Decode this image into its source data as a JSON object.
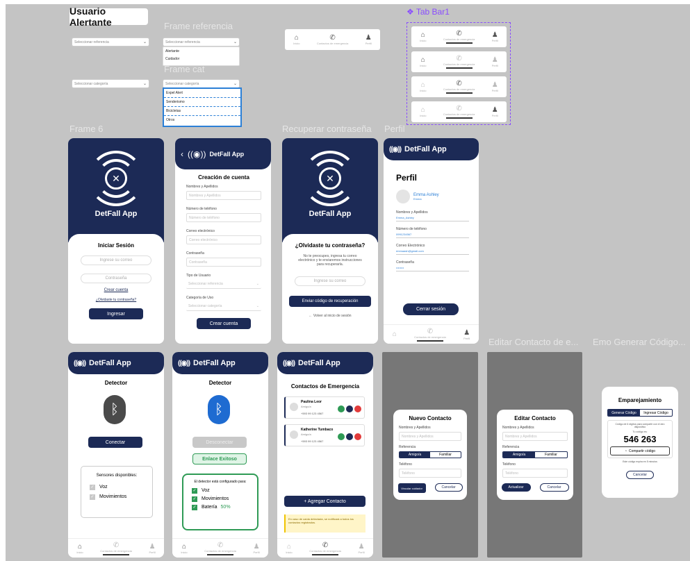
{
  "title": "Usuario Alertante",
  "labels": {
    "frame_referencia": "Frame referencia",
    "frame_cat": "Frame cat",
    "tab_bar": "Tab Bar1",
    "frame6": "Frame 6",
    "recuperar": "Recuperar contraseña",
    "perfil": "Perfil",
    "editar_contacto": "Editar Contacto de e...",
    "generar_codigo": "Emo Generar Código..."
  },
  "selects": {
    "referencia": "Seleccionar referencia",
    "categoria": "Seleccionar categoría",
    "ref_options": [
      "Alertante",
      "Cuidador"
    ],
    "cat_options": [
      "Expel Alert",
      "Senderismo",
      "Bicicletas",
      "Otros"
    ]
  },
  "tabs": {
    "inicio": "Inicio",
    "contactos": "Contactos de emergencia",
    "perfil": "Perfil"
  },
  "app_name": "DetFall App",
  "login": {
    "title": "Iniciar Sesión",
    "email": "Ingrese su correo",
    "password": "Contraseña",
    "create": "Crear cuenta",
    "forgot": "¿Olvidaste tu contraseña?",
    "submit": "Ingresar"
  },
  "signup": {
    "title": "Creación de cuenta",
    "name_label": "Nombres y Apellidos",
    "name_ph": "Nombres y Apellidos",
    "phone_label": "Número de teléfono",
    "phone_ph": "Número de teléfono",
    "email_label": "Correo electrónico",
    "email_ph": "Correo electrónico",
    "pass_label": "Contraseña",
    "pass_ph": "Contraseña",
    "type_label": "Tipo de Usuario",
    "type_sel": "Seleccionar referencia",
    "cat_label": "Categoría de Uso",
    "cat_sel": "Seleccionar categoría",
    "submit": "Crear cuenta"
  },
  "recover": {
    "title": "¿Olvidaste tu contraseña?",
    "desc": "No te preocupes, ingresa tu correo electrónico y te enviaremos instrucciones para recuperarla.",
    "email": "Ingrese su correo",
    "submit": "Enviar código de recuperación",
    "back": "Volver al inicio de sesión"
  },
  "profile": {
    "title": "Perfil",
    "name": "Emma Ashley",
    "role": "Emma",
    "f1_label": "Nombres y Apellidos",
    "f1_val": "Emma_Ashley",
    "f2_label": "Número de teléfono",
    "f2_val": "0991234567",
    "f3_label": "Correo Electrónico",
    "f3_val": "emmaash@gmail.com",
    "f4_label": "Contraseña",
    "f4_val": "••••••••",
    "logout": "Cerrar sesión"
  },
  "detector1": {
    "title": "Detector",
    "connect": "Conectar",
    "sensors_title": "Sensores disponibles:",
    "s1": "Voz",
    "s2": "Movimientos"
  },
  "detector2": {
    "title": "Detector",
    "disconnect": "Desconectar",
    "success": "Enlace Exitoso",
    "config": "El detector está configurado para:",
    "s1": "Voz",
    "s2": "Movimientos",
    "s3": "Batería",
    "battery": "50%"
  },
  "contacts": {
    "title": "Contactos de Emergencia",
    "c1_name": "Paulina Leor",
    "c1_rel": "Amigo/a",
    "c1_phone": "+593 99 123 4567",
    "c2_name": "Katherine Tumbaco",
    "c2_rel": "Amigo/a",
    "c2_phone": "+593 99 123 4567",
    "add": "+ Agregar Contacto",
    "note": "En caso de caída detectada, se notificará a todos los contactos registrados."
  },
  "new_contact": {
    "title": "Nuevo Contacto",
    "name_label": "Nombres y Apellidos",
    "name_ph": "Nombres y Apellidos",
    "ref_label": "Referencia",
    "opt1": "Amigo/a",
    "opt2": "Familiar",
    "phone_label": "Teléfono",
    "phone_ph": "Teléfono",
    "save": "Vincular cuidador",
    "cancel": "Cancelar"
  },
  "edit_contact": {
    "title": "Editar Contacto",
    "name_label": "Nombres y Apellidos",
    "name_ph": "Nombres y Apellidos",
    "ref_label": "Referencia",
    "opt1": "Amigo/a",
    "opt2": "Familiar",
    "phone_label": "Teléfono",
    "phone_ph": "Teléfono",
    "save": "Actualizar",
    "cancel": "Cancelar"
  },
  "pairing": {
    "title": "Emparejamiento",
    "tab1": "Generar Código",
    "tab2": "Ingresar Código",
    "desc": "Código de 6 dígitos para compartir con el otro dispositivo",
    "code_label": "Tu código es:",
    "code": "546 263",
    "share": "Compartir código",
    "expires": "Este código expira en 5 minutos",
    "cancel": "Cancelar"
  },
  "colors": {
    "navy": "#1c2a56",
    "green": "#2e9a55",
    "purple": "#8a4dff",
    "gray_bg": "#c4c4c4"
  }
}
